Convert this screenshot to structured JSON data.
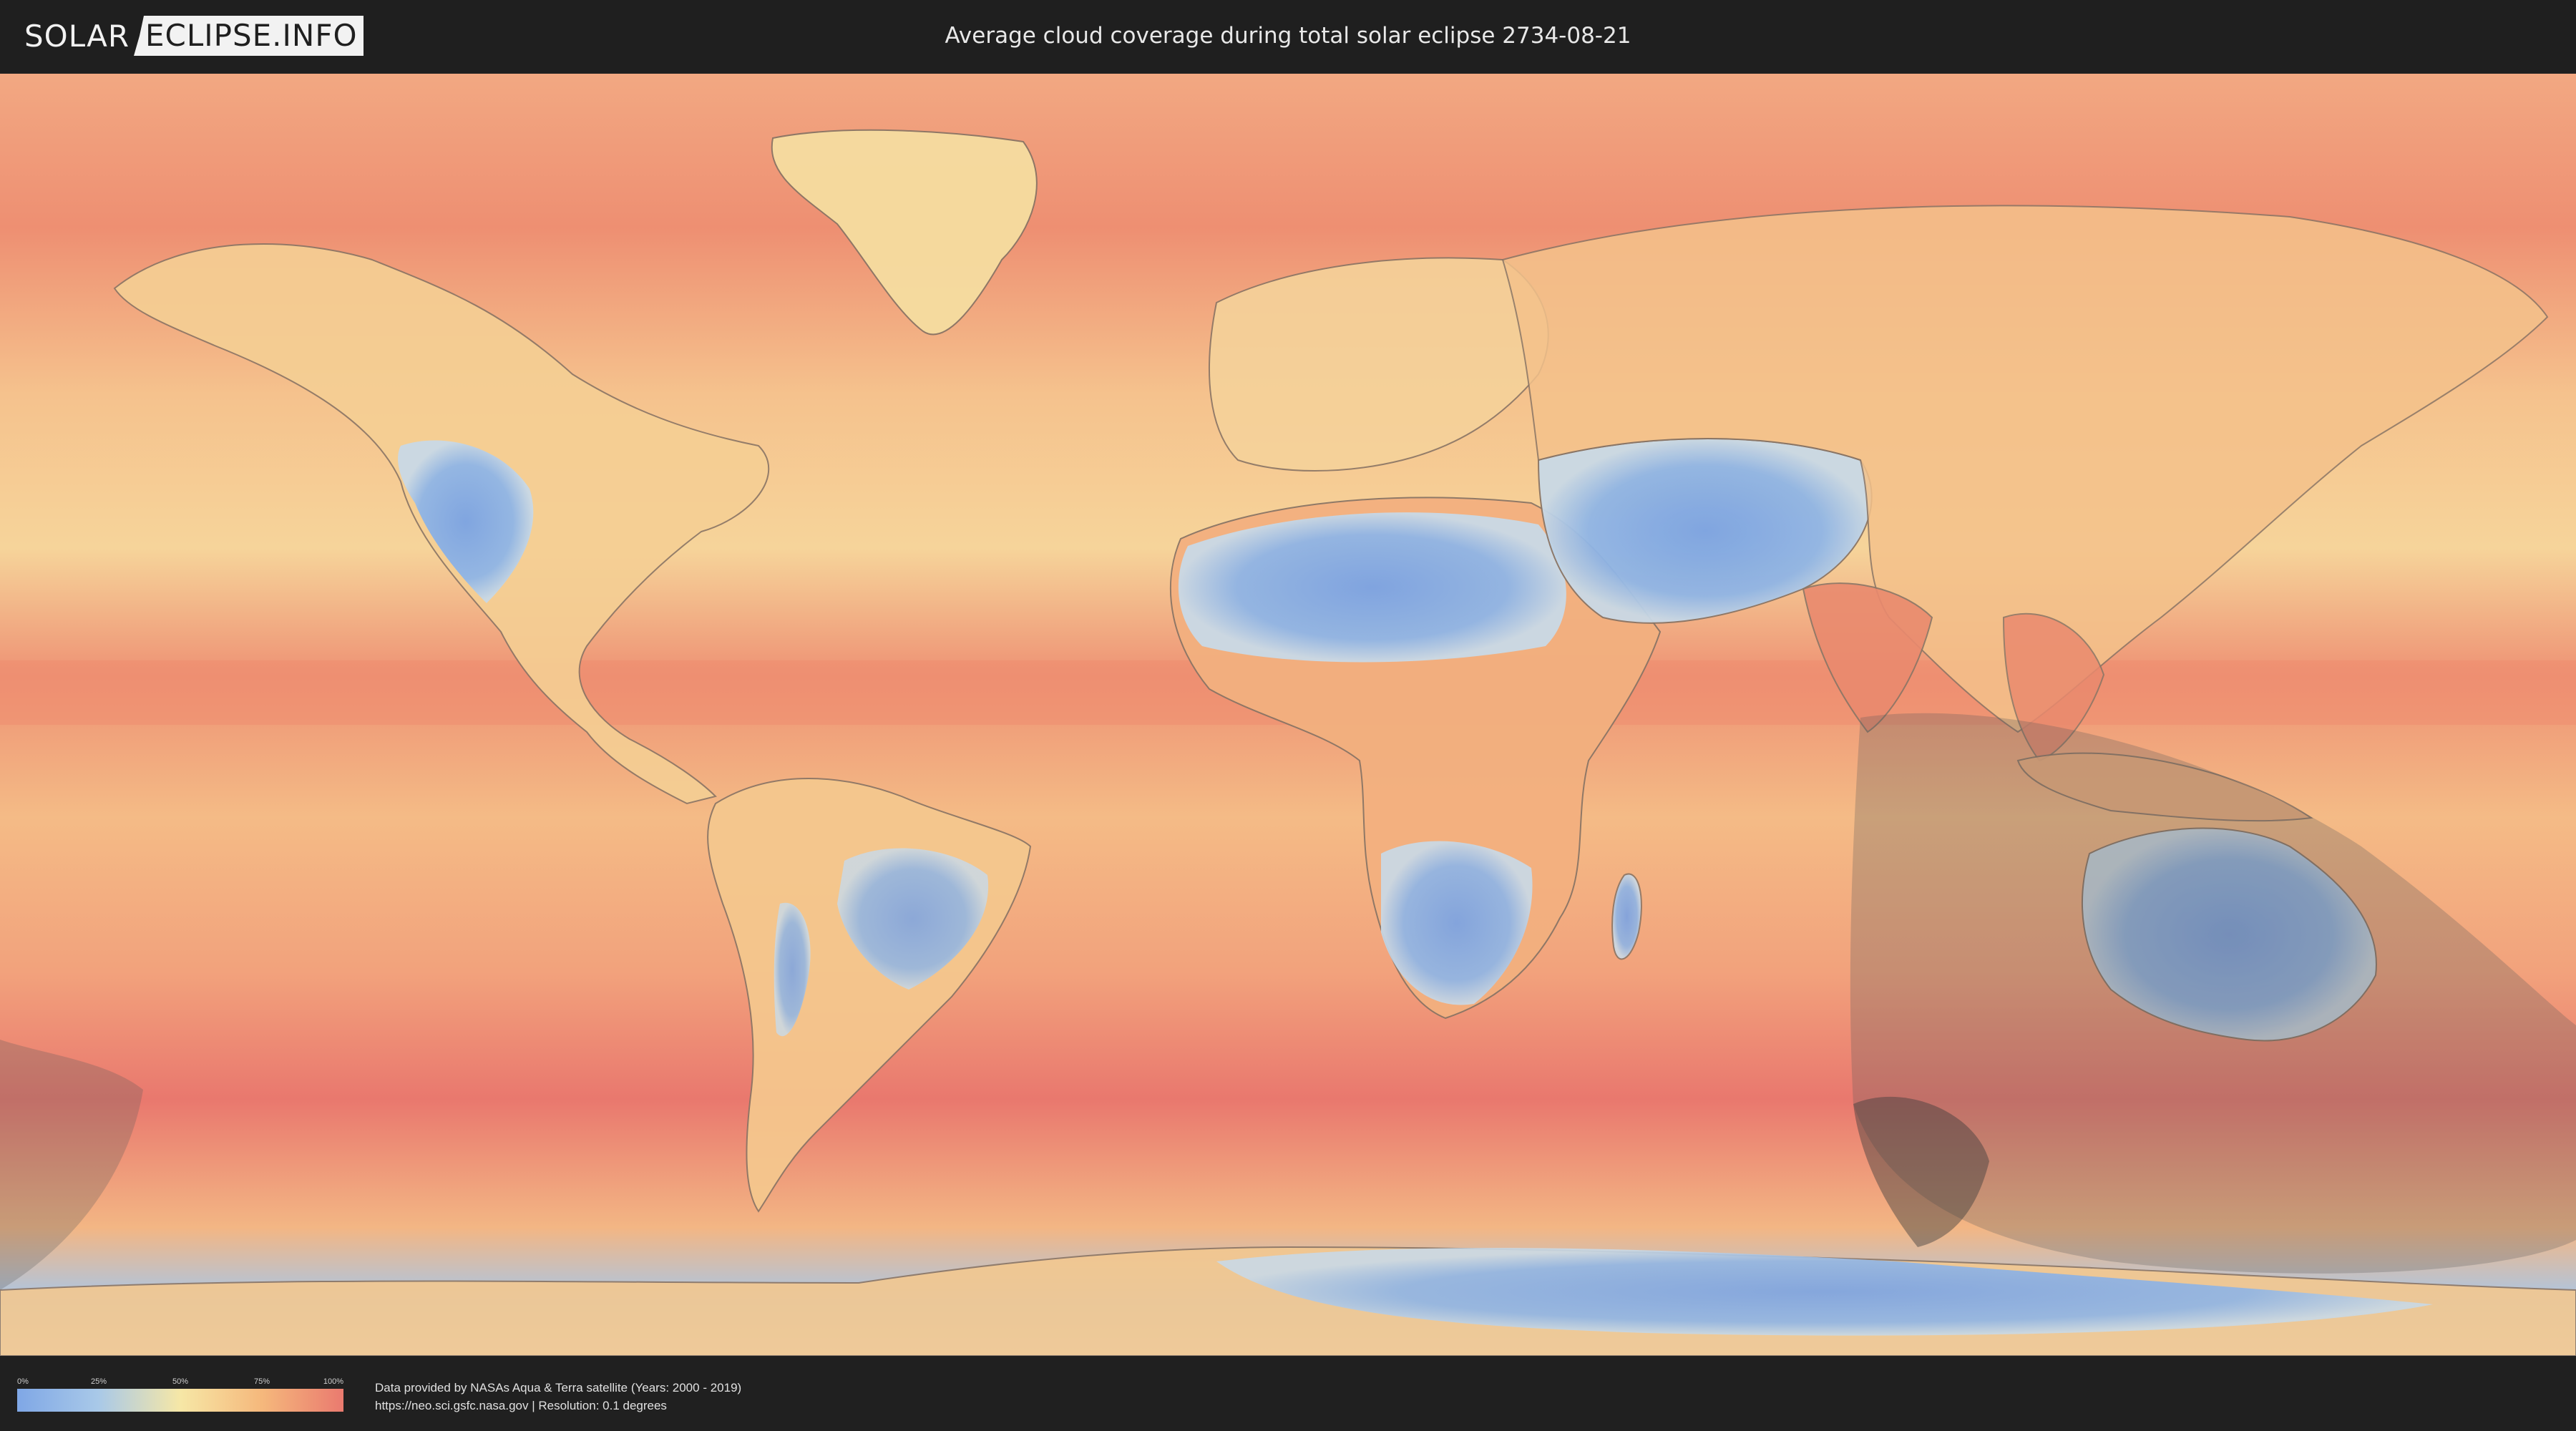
{
  "header": {
    "logo_left": "SOLAR",
    "logo_right": "ECLIPSE.INFO",
    "title": "Average cloud coverage during total solar eclipse 2734-08-21"
  },
  "legend": {
    "ticks": [
      "0%",
      "25%",
      "50%",
      "75%",
      "100%"
    ],
    "gradient_colors": [
      "#7fa7e6",
      "#a9c9e8",
      "#f6e7a6",
      "#f5b87c",
      "#ea7a6f"
    ]
  },
  "credits": {
    "line1": "Data provided by NASAs Aqua & Terra satellite (Years: 2000 - 2019)",
    "line2": "https://neo.sci.gsfc.nasa.gov | Resolution: 0.1 degrees"
  },
  "map": {
    "projection": "equirectangular world map",
    "overlay_color": "#5a5a5a",
    "ocean_color": "#f0a078",
    "land_clear_color": "#86aee6"
  }
}
